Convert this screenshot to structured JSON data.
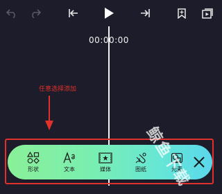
{
  "toolbar": {
    "undo_icon": "undo-icon",
    "redo_icon": "redo-icon",
    "skip_start_icon": "skip-to-start-icon",
    "play_icon": "play-icon",
    "skip_end_icon": "skip-to-end-icon",
    "bookmark_icon": "bookmark-add-icon",
    "export_icon": "export-play-icon"
  },
  "timeline": {
    "timecode": "00:00:00"
  },
  "annotation": {
    "note": "任意选择添加",
    "color": "#e0312b"
  },
  "add_panel": {
    "items": [
      {
        "label": "形状",
        "icon": "shapes-icon"
      },
      {
        "label": "文本",
        "icon": "text-icon"
      },
      {
        "label": "媒体",
        "icon": "media-icon"
      },
      {
        "label": "图纸",
        "icon": "drawing-icon"
      },
      {
        "label": "元素",
        "icon": "elements-icon"
      }
    ],
    "close_icon": "close-icon"
  },
  "watermark": "鲸鱼下载"
}
